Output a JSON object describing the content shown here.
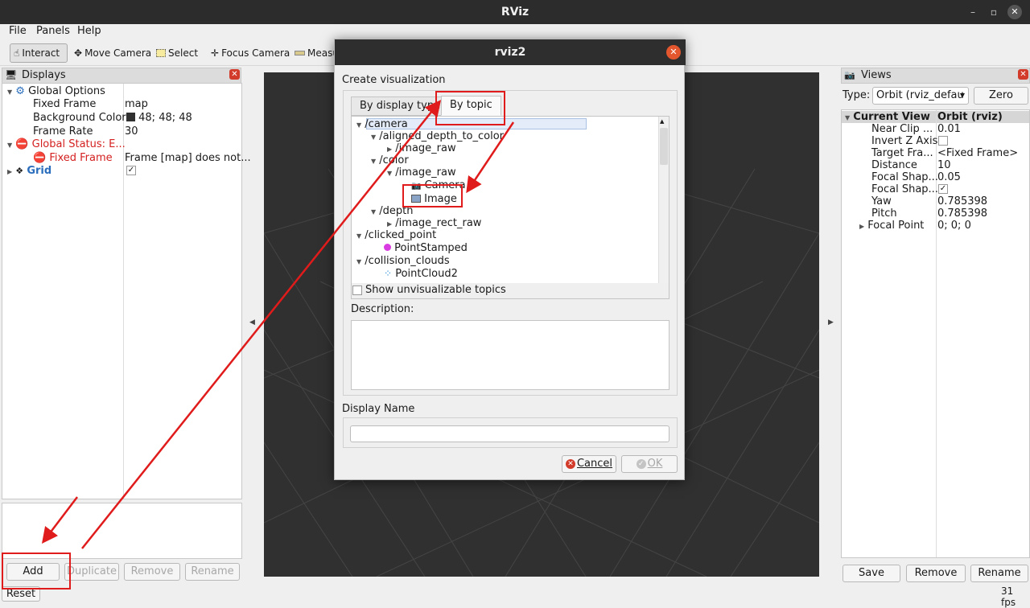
{
  "window": {
    "title": "RViz"
  },
  "menu": [
    "File",
    "Panels",
    "Help"
  ],
  "toolbar": {
    "interact": "Interact",
    "move_camera": "Move Camera",
    "select": "Select",
    "focus_camera": "Focus Camera",
    "measure": "Measu"
  },
  "displays": {
    "title": "Displays",
    "global_options": "Global Options",
    "fixed_frame_label": "Fixed Frame",
    "fixed_frame_value": "map",
    "bg_color_label": "Background Color",
    "bg_color_value": "48; 48; 48",
    "frame_rate_label": "Frame Rate",
    "frame_rate_value": "30",
    "global_status": "Global Status: E...",
    "status_fixed_frame": "Fixed Frame",
    "status_fixed_frame_value": "Frame [map] does not...",
    "grid": "Grid",
    "buttons": {
      "add": "Add",
      "duplicate": "Duplicate",
      "remove": "Remove",
      "rename": "Rename"
    },
    "reset": "Reset"
  },
  "views": {
    "title": "Views",
    "type_label": "Type:",
    "type_value": "Orbit (rviz_defau",
    "zero": "Zero",
    "current_view": "Current View",
    "current_view_value": "Orbit (rviz)",
    "props": [
      {
        "name": "Near Clip ...",
        "value": "0.01"
      },
      {
        "name": "Invert Z Axis",
        "value": ""
      },
      {
        "name": "Target Fra...",
        "value": "<Fixed Frame>"
      },
      {
        "name": "Distance",
        "value": "10"
      },
      {
        "name": "Focal Shap...",
        "value": "0.05"
      },
      {
        "name": "Focal Shap...",
        "value": ""
      },
      {
        "name": "Yaw",
        "value": "0.785398"
      },
      {
        "name": "Pitch",
        "value": "0.785398"
      },
      {
        "name": "Focal Point",
        "value": "0; 0; 0"
      }
    ],
    "buttons": {
      "save": "Save",
      "remove": "Remove",
      "rename": "Rename"
    }
  },
  "status": {
    "fps": "31 fps"
  },
  "dialog": {
    "title": "rviz2",
    "heading": "Create visualization",
    "tab_display_type": "By display type",
    "tab_topic": "By topic",
    "tree": {
      "camera": "/camera",
      "aligned": "/aligned_depth_to_color",
      "image_raw_1": "/image_raw",
      "color": "/color",
      "image_raw_2": "/image_raw",
      "camera_item": "Camera",
      "image_item": "Image",
      "depth": "/depth",
      "image_rect_raw": "/image_rect_raw",
      "clicked_point": "/clicked_point",
      "point_stamped": "PointStamped",
      "collision_clouds": "/collision_clouds",
      "point_cloud2": "PointCloud2"
    },
    "show_unvisualizable": "Show unvisualizable topics",
    "description_label": "Description:",
    "display_name_label": "Display Name",
    "display_name_value": "",
    "cancel": "Cancel",
    "ok": "OK"
  },
  "colors": {
    "accent_red": "#e01b1b",
    "dark_bg": "#303030",
    "status_error": "#d42020",
    "grid_blue": "#2a6ebd"
  }
}
